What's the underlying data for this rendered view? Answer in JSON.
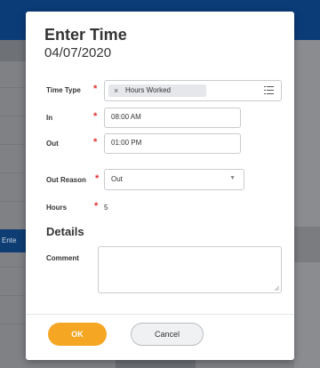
{
  "background": {
    "left_tab_text": "Ente"
  },
  "dialog": {
    "title": "Enter Time",
    "date": "04/07/2020",
    "fields": {
      "time_type": {
        "label": "Time Type",
        "value": "Hours Worked"
      },
      "in": {
        "label": "In",
        "value": "08:00 AM"
      },
      "out": {
        "label": "Out",
        "value": "01:00 PM"
      },
      "out_reason": {
        "label": "Out Reason",
        "value": "Out"
      },
      "hours": {
        "label": "Hours",
        "value": "5"
      }
    },
    "details": {
      "title": "Details",
      "comment_label": "Comment",
      "comment_value": ""
    },
    "required_marker": "*",
    "buttons": {
      "ok": "OK",
      "cancel": "Cancel"
    }
  },
  "colors": {
    "accent_ok": "#f5a623",
    "required": "#e02f2f",
    "header": "#0b3c78"
  },
  "icons": {
    "remove_pill": "x-icon",
    "prompt_list": "list-icon",
    "dropdown": "chevron-down-icon"
  }
}
